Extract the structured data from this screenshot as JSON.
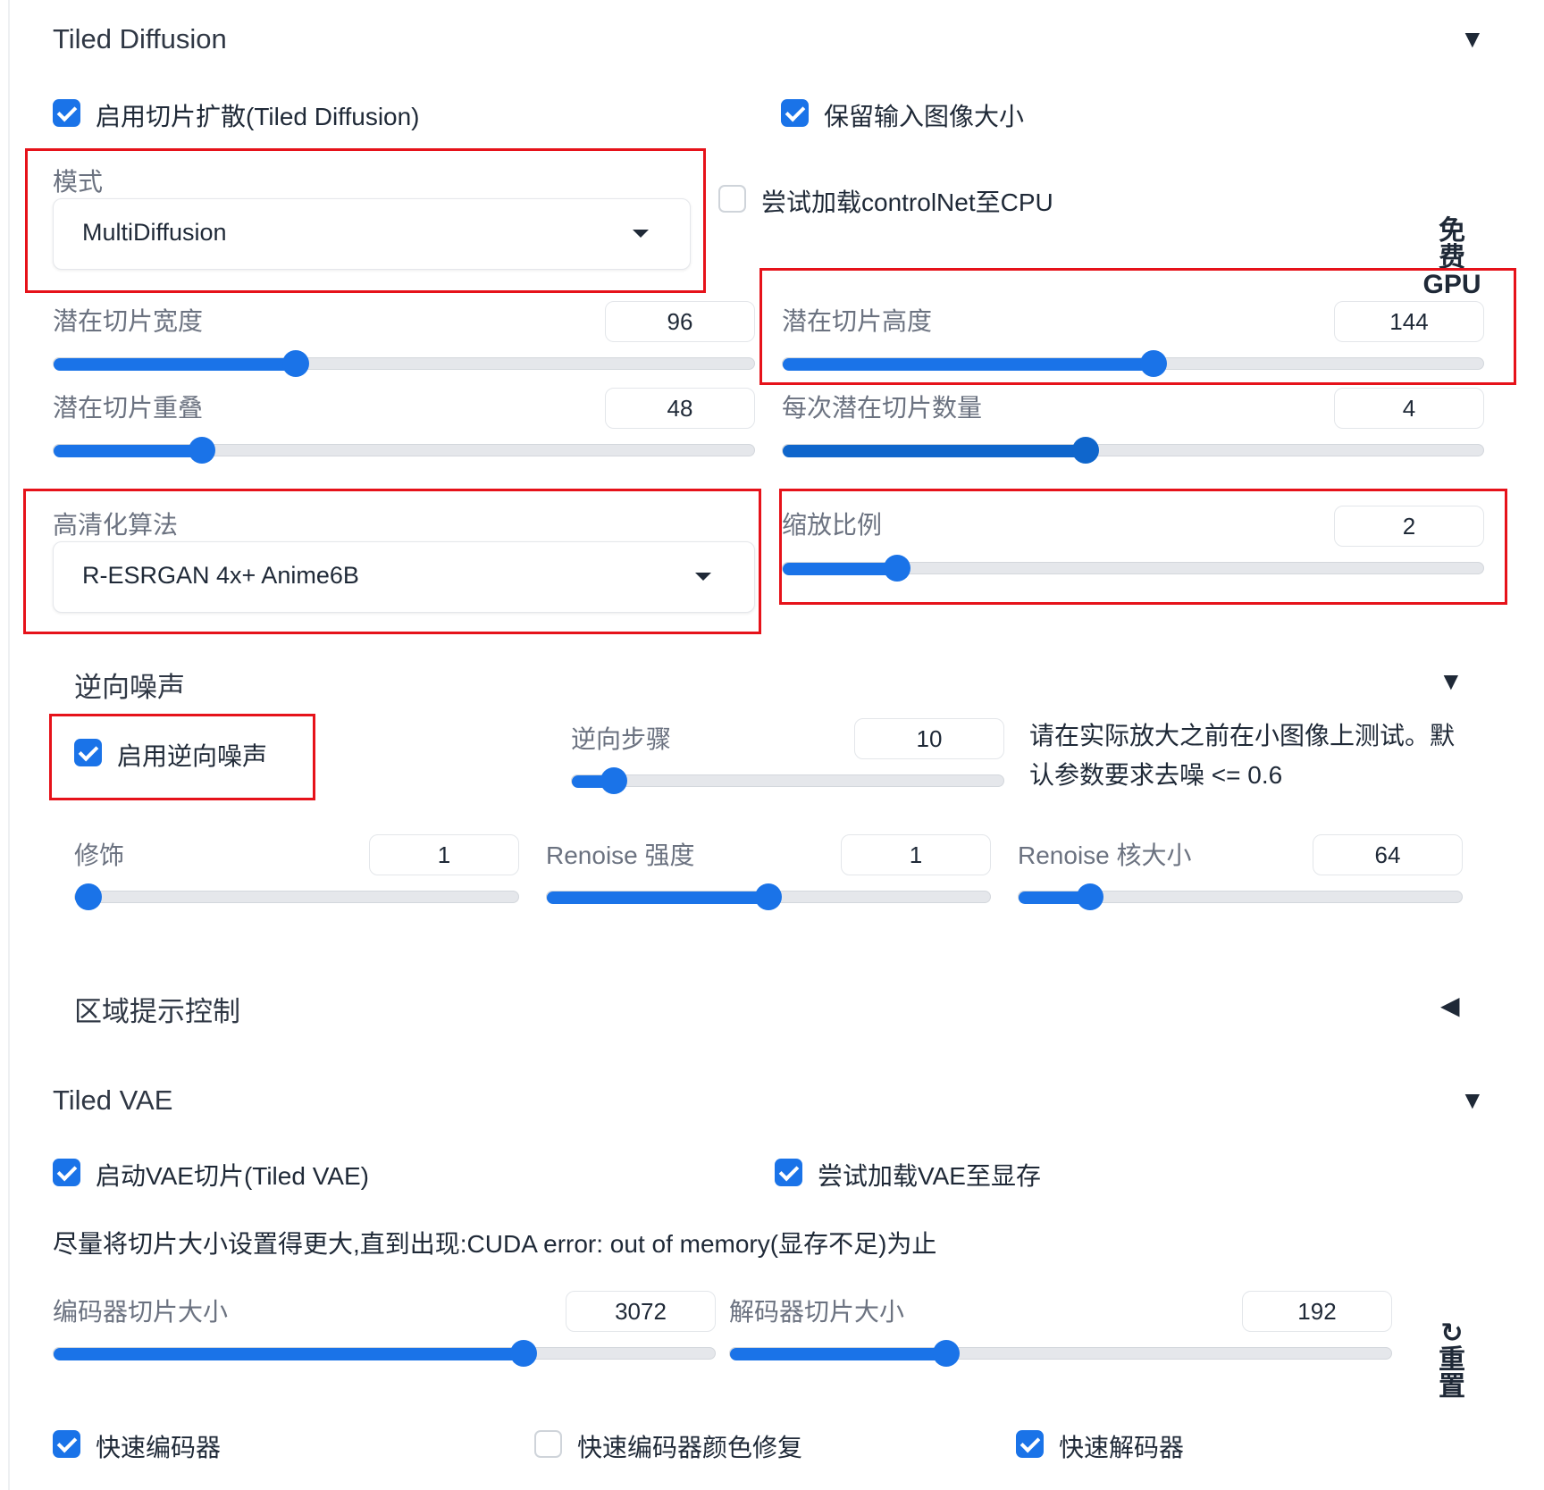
{
  "tiled_diffusion": {
    "title": "Tiled Diffusion",
    "caret": "▼",
    "enable_label": "启用切片扩散(Tiled Diffusion)",
    "enable_checked": true,
    "keep_size_label": "保留输入图像大小",
    "keep_size_checked": true,
    "mode_label": "模式",
    "mode_value": "MultiDiffusion",
    "controlnet_cpu_label": "尝试加载controlNet至CPU",
    "controlnet_cpu_checked": false,
    "free_gpu_line1": "免",
    "free_gpu_line2": "费",
    "free_gpu_line3": "GPU",
    "tile_width_label": "潜在切片宽度",
    "tile_width_value": "96",
    "tile_height_label": "潜在切片高度",
    "tile_height_value": "144",
    "tile_overlap_label": "潜在切片重叠",
    "tile_overlap_value": "48",
    "tile_batch_label": "每次潜在切片数量",
    "tile_batch_value": "4",
    "upscaler_label": "高清化算法",
    "upscaler_value": "R-ESRGAN 4x+ Anime6B",
    "scale_label": "缩放比例",
    "scale_value": "2"
  },
  "noise_inversion": {
    "title": "逆向噪声",
    "caret": "▼",
    "enable_label": "启用逆向噪声",
    "enable_checked": true,
    "steps_label": "逆向步骤",
    "steps_value": "10",
    "hint_line1": "请在实际放大之前在小图像上测试。默",
    "hint_line2": "认参数要求去噪 <= 0.6",
    "retouch_label": "修饰",
    "retouch_value": "1",
    "renoise_strength_label": "Renoise 强度",
    "renoise_strength_value": "1",
    "renoise_kernel_label": "Renoise 核大小",
    "renoise_kernel_value": "64"
  },
  "region_prompt": {
    "title": "区域提示控制",
    "caret": "◀"
  },
  "tiled_vae": {
    "title": "Tiled VAE",
    "caret": "▼",
    "enable_label": "启动VAE切片(Tiled VAE)",
    "enable_checked": true,
    "vae_to_gpu_label": "尝试加载VAE至显存",
    "vae_to_gpu_checked": true,
    "hint": "尽量将切片大小设置得更大,直到出现:CUDA error: out of memory(显存不足)为止",
    "encoder_label": "编码器切片大小",
    "encoder_value": "3072",
    "decoder_label": "解码器切片大小",
    "decoder_value": "192",
    "reset_icon": "↻",
    "reset_line1": "重",
    "reset_line2": "置",
    "fast_encoder_label": "快速编码器",
    "fast_encoder_checked": true,
    "fast_encoder_color_label": "快速编码器颜色修复",
    "fast_encoder_color_checked": false,
    "fast_decoder_label": "快速解码器",
    "fast_decoder_checked": true
  },
  "sliders": {
    "tile_width": 0.34,
    "tile_height": 0.53,
    "tile_overlap": 0.2,
    "tile_batch": 0.43,
    "scale": 0.15,
    "noise_steps": 0.07,
    "retouch": 0.0,
    "renoise_strength": 0.5,
    "renoise_kernel": 0.14,
    "encoder": 0.72,
    "decoder": 0.32
  },
  "colors": {
    "accent": "#1a73e8",
    "annotation_red": "#e6121a"
  }
}
